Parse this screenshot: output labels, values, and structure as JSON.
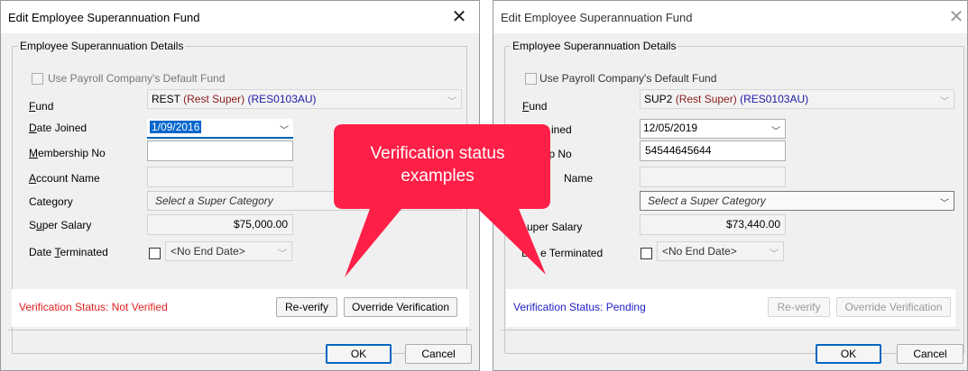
{
  "dialogs": [
    {
      "title": "Edit Employee Superannuation Fund",
      "close_symbol": "✕",
      "group_title": "Employee Superannuation Details",
      "use_default_fund_label": "Use Payroll Company's Default Fund",
      "fund_label": "Fund",
      "fund_code": "REST",
      "fund_name": "(Rest Super)",
      "fund_usi": "(RES0103AU)",
      "date_joined_label": "Date Joined",
      "date_joined_value": "1/09/2016",
      "membership_label": "Membership No",
      "membership_value": "",
      "account_name_label": "Account Name",
      "account_name_value": "",
      "category_label": "Category",
      "category_placeholder": "Select a Super Category",
      "super_salary_label": "Super Salary",
      "super_salary_value": "$75,000.00",
      "date_terminated_label": "Date Terminated",
      "end_date_value": "<No End Date>",
      "verification_status": "Verification Status: Not Verified",
      "verification_color": "#e02020",
      "reverify_label": "Re-verify",
      "override_label": "Override Verification",
      "ok_label": "OK",
      "cancel_label": "Cancel"
    },
    {
      "title": "Edit Employee Superannuation Fund",
      "close_symbol": "✕",
      "group_title": "Employee Superannuation Details",
      "use_default_fund_label": "Use Payroll Company's Default Fund",
      "fund_label": "Fund",
      "fund_code": "SUP2",
      "fund_name": "(Rest Super)",
      "fund_usi": "(RES0103AU)",
      "date_joined_label_visible": "ined",
      "date_joined_value": "12/05/2019",
      "membership_label_visible": "hip No",
      "membership_value": "54544645644",
      "account_name_label_visible": "Name",
      "account_name_value": "",
      "category_placeholder": "Select a Super Category",
      "super_salary_label_visible": "uper Salary",
      "super_salary_value": "$73,440.00",
      "date_terminated_label_visible_a": "D",
      "date_terminated_label_visible_b": "e Terminated",
      "end_date_value": "<No End Date>",
      "verification_status": "Verification Status: Pending",
      "verification_color": "#2020c8",
      "reverify_label": "Re-verify",
      "override_label": "Override Verification",
      "ok_label": "OK",
      "cancel_label": "Cancel"
    }
  ],
  "callout": {
    "line1": "Verification status",
    "line2": "examples",
    "color": "#ff1f47"
  }
}
